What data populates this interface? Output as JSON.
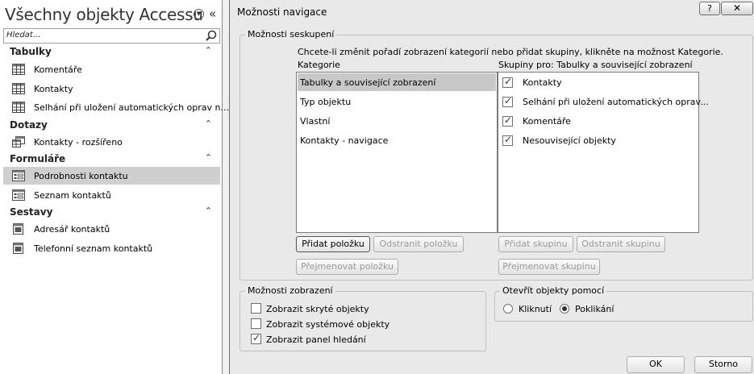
{
  "nav": {
    "title": "Všechny objekty Accessu",
    "search_placeholder": "Hledat...",
    "groups": [
      {
        "label": "Tabulky",
        "items": [
          "Komentáře",
          "Kontakty",
          "Selhání při uložení automatických oprav n..."
        ]
      },
      {
        "label": "Dotazy",
        "items": [
          "Kontakty - rozšířeno"
        ]
      },
      {
        "label": "Formuláře",
        "items": [
          "Podrobnosti kontaktu",
          "Seznam kontaktů"
        ]
      },
      {
        "label": "Sestavy",
        "items": [
          "Adresář kontaktů",
          "Telefonní seznam kontaktů"
        ]
      }
    ],
    "selected_item": "Podrobnosti kontaktu"
  },
  "dialog": {
    "title": "Možnosti navigace",
    "help_label": "?",
    "close_label": "✕",
    "grouping": {
      "legend": "Možnosti seskupení",
      "instruction": "Chcete-li změnit pořadí zobrazení kategorií nebo přidat skupiny, klikněte na možnost Kategorie.",
      "categories_header": "Kategorie",
      "groups_header": "Skupiny pro: Tabulky a související zobrazení",
      "categories": [
        "Tabulky a související zobrazení",
        "Typ objektu",
        "Vlastní",
        "Kontakty - navigace"
      ],
      "selected_category": "Tabulky a související zobrazení",
      "groups": [
        {
          "label": "Kontakty",
          "checked": true
        },
        {
          "label": "Selhání při uložení automatických oprav...",
          "checked": true
        },
        {
          "label": "Komentáře",
          "checked": true
        },
        {
          "label": "Nesouvisející objekty",
          "checked": true
        }
      ],
      "add_item": "Přidat položku",
      "remove_item": "Odstranit položku",
      "rename_item": "Přejmenovat položku",
      "add_group": "Přidat skupinu",
      "remove_group": "Odstranit skupinu",
      "rename_group": "Přejmenovat skupinu"
    },
    "display": {
      "legend": "Možnosti zobrazení",
      "options": [
        {
          "label": "Zobrazit skryté objekty",
          "checked": false
        },
        {
          "label": "Zobrazit systémové objekty",
          "checked": false
        },
        {
          "label": "Zobrazit panel hledání",
          "checked": true
        }
      ]
    },
    "open": {
      "legend": "Otevřít objekty pomocí",
      "options": [
        {
          "label": "Kliknutí",
          "selected": false
        },
        {
          "label": "Poklikání",
          "selected": true
        }
      ]
    },
    "ok": "OK",
    "cancel": "Storno"
  }
}
